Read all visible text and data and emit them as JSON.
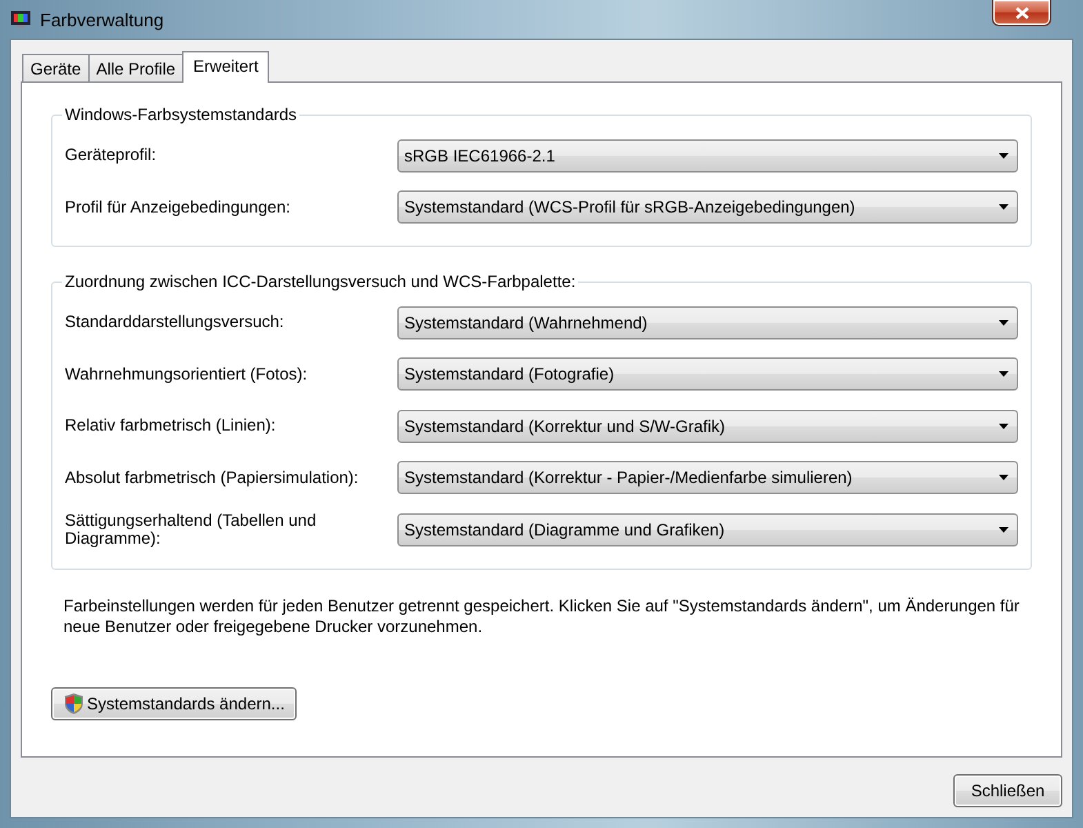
{
  "window": {
    "title": "Farbverwaltung"
  },
  "tabs": [
    {
      "label": "Geräte",
      "selected": false
    },
    {
      "label": "Alle Profile",
      "selected": false
    },
    {
      "label": "Erweitert",
      "selected": true
    }
  ],
  "groups": [
    {
      "title": "Windows-Farbsystemstandards",
      "rows": [
        {
          "label": "Geräteprofil:",
          "value": "sRGB IEC61966-2.1"
        },
        {
          "label": "Profil für Anzeigebedingungen:",
          "value": "Systemstandard (WCS-Profil für sRGB-Anzeigebedingungen)"
        }
      ]
    },
    {
      "title": "Zuordnung zwischen ICC-Darstellungsversuch und WCS-Farbpalette:",
      "rows": [
        {
          "label": "Standarddarstellungsversuch:",
          "value": "Systemstandard (Wahrnehmend)"
        },
        {
          "label": "Wahrnehmungsorientiert (Fotos):",
          "value": "Systemstandard (Fotografie)"
        },
        {
          "label": "Relativ farbmetrisch (Linien):",
          "value": "Systemstandard (Korrektur und S/W-Grafik)"
        },
        {
          "label": "Absolut farbmetrisch (Papiersimulation):",
          "value": "Systemstandard (Korrektur - Papier-/Medienfarbe simulieren)"
        },
        {
          "label": "Sättigungserhaltend (Tabellen und Diagramme):",
          "value": "Systemstandard (Diagramme und Grafiken)"
        }
      ]
    }
  ],
  "info_text": "Farbeinstellungen werden für jeden Benutzer getrennt gespeichert. Klicken Sie auf \"Systemstandards ändern\", um Änderungen für neue Benutzer oder freigegebene Drucker vorzunehmen.",
  "change_defaults_button": "Systemstandards ändern...",
  "close_button": "Schließen"
}
